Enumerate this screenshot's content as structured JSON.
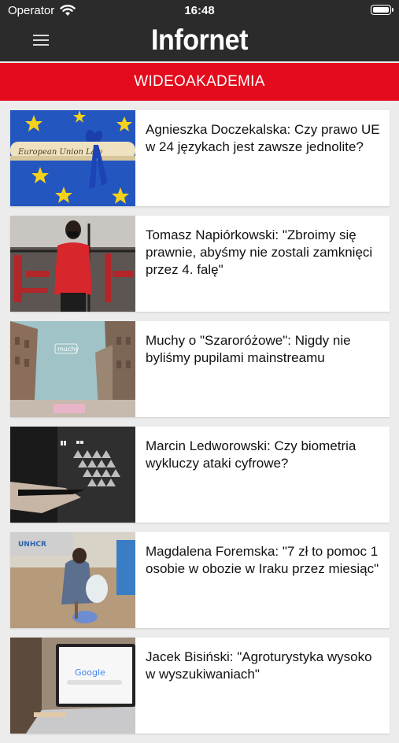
{
  "status_bar": {
    "carrier": "Operator",
    "time": "16:48"
  },
  "header": {
    "title": "Infornet",
    "menu_icon": "hamburger-menu-icon"
  },
  "section": {
    "title": "WIDEOAKADEMIA"
  },
  "colors": {
    "header_bg": "#2b2b2b",
    "accent": "#e30b1c",
    "background": "#ececec"
  },
  "articles": [
    {
      "title": "Agnieszka Doczekalska: Czy prawo UE w 24 językach jest zawsze jednolite?",
      "thumb_text": "European Union Law"
    },
    {
      "title": "Tomasz Napiórkowski: \"Zbroimy się prawnie, abyśmy nie zostali zamknięci przez 4. falę\""
    },
    {
      "title": "Muchy o \"Szaroróżowe\": Nigdy nie byliśmy pupilami mainstreamu",
      "thumb_text": "muchy"
    },
    {
      "title": "Marcin Ledworowski: Czy biometria wykluczy ataki cyfrowe?"
    },
    {
      "title": "Magdalena Foremska: \"7 zł to pomoc 1 osobie w obozie w Iraku przez miesiąc\"",
      "thumb_text": "UNHCR"
    },
    {
      "title": "Jacek Bisiński: \"Agroturystyka wysoko w wyszukiwaniach\"",
      "thumb_text": "Google"
    }
  ]
}
